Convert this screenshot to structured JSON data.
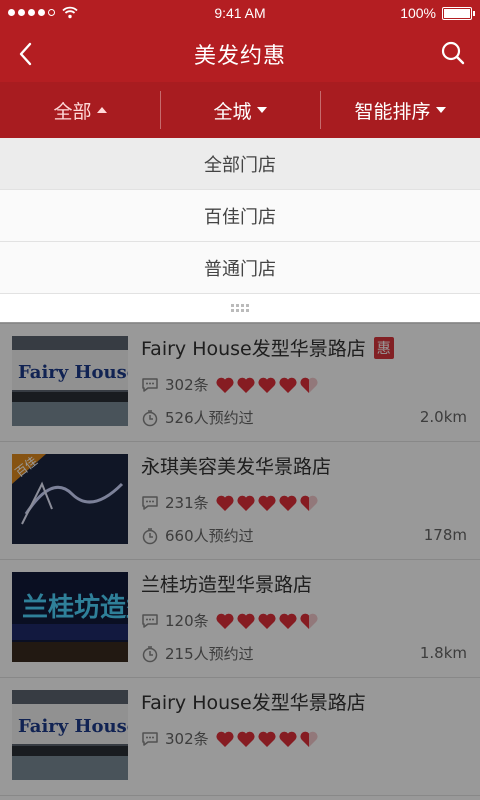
{
  "status_bar": {
    "time": "9:41 AM",
    "battery": "100%"
  },
  "header": {
    "title": "美发约惠"
  },
  "filters": [
    {
      "label": "全部",
      "caret": "up",
      "active": true
    },
    {
      "label": "全城",
      "caret": "down",
      "active": false
    },
    {
      "label": "智能排序",
      "caret": "down",
      "active": false
    }
  ],
  "dropdown": {
    "items": [
      {
        "label": "全部门店",
        "selected": true
      },
      {
        "label": "百佳门店",
        "selected": false
      },
      {
        "label": "普通门店",
        "selected": false
      }
    ]
  },
  "shops": [
    {
      "name": "",
      "reviews": "",
      "bookings": "215人预约过",
      "distance": "1.8km",
      "hui": false,
      "rating": 4.5,
      "sign": "兰桂坊",
      "badge": ""
    },
    {
      "name": "Fairy House发型华景路店",
      "reviews": "302条",
      "bookings": "526人预约过",
      "distance": "2.0km",
      "hui": true,
      "rating": 4.5,
      "sign": "Fairy House",
      "badge": ""
    },
    {
      "name": "永琪美容美发华景路店",
      "reviews": "231条",
      "bookings": "660人预约过",
      "distance": "178m",
      "hui": false,
      "rating": 4.5,
      "sign": "永琪",
      "badge": "百佳"
    },
    {
      "name": "兰桂坊造型华景路店",
      "reviews": "120条",
      "bookings": "215人预约过",
      "distance": "1.8km",
      "hui": false,
      "rating": 4.5,
      "sign": "兰桂坊",
      "badge": ""
    },
    {
      "name": "Fairy House发型华景路店",
      "reviews": "302条",
      "bookings": "",
      "distance": "",
      "hui": false,
      "rating": 4.5,
      "sign": "Fairy House",
      "badge": ""
    }
  ],
  "icons": {
    "back": "chevron-left-icon",
    "search": "search-icon",
    "comment": "comment-icon",
    "timer": "timer-icon",
    "heart": "heart-icon"
  },
  "colors": {
    "brand": "#b41e22",
    "filter_bar": "#a81c20",
    "heart": "#e0303a",
    "hui": "#d9363c"
  }
}
